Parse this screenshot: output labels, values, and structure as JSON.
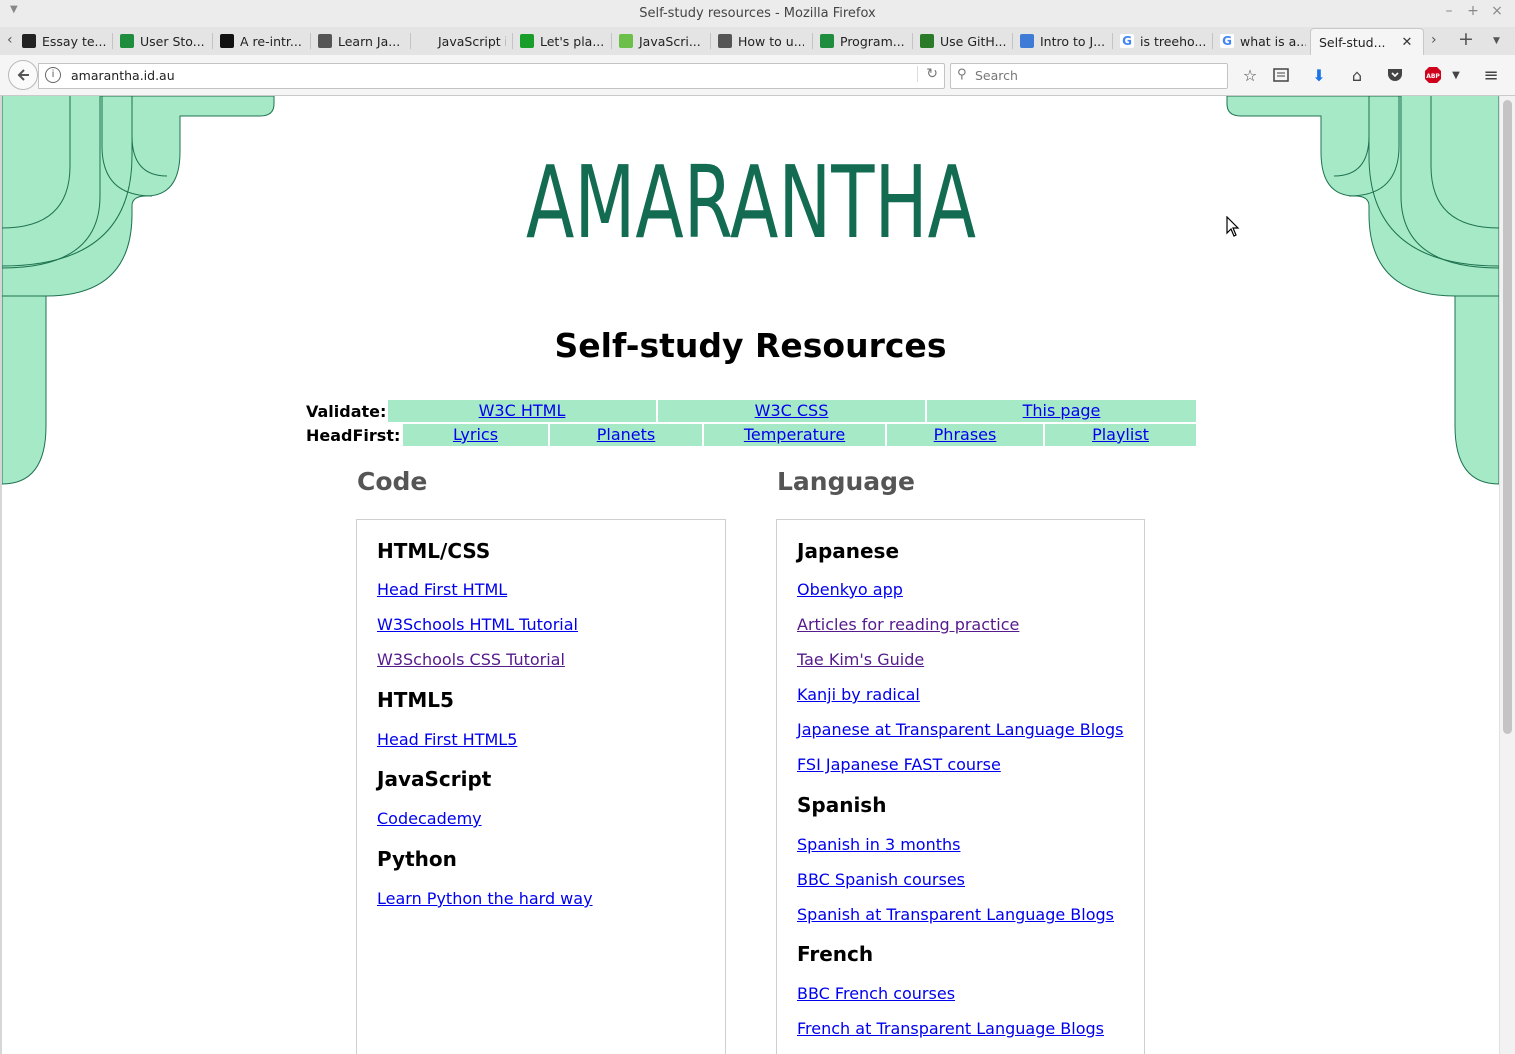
{
  "window": {
    "title": "Self-study resources - Mozilla Firefox"
  },
  "tabs": [
    {
      "label": "Essay te...",
      "icon": "text-icon",
      "color": "#222"
    },
    {
      "label": "User Sto...",
      "icon": "sheets-icon",
      "color": "#1e8e3e"
    },
    {
      "label": "A re-intr...",
      "icon": "mdn-icon",
      "color": "#111"
    },
    {
      "label": "Learn Ja...",
      "icon": "codecademy-icon",
      "color": "#555"
    },
    {
      "label": "JavaScript in ...",
      "icon": "blank-icon",
      "color": "#e4e4e4"
    },
    {
      "label": "Let's pla...",
      "icon": "eye-icon",
      "color": "#1a9e2a"
    },
    {
      "label": "JavaScri...",
      "icon": "w3-icon",
      "color": "#6cc04a"
    },
    {
      "label": "How to u...",
      "icon": "codecademy-icon",
      "color": "#555"
    },
    {
      "label": "Program...",
      "icon": "sheets-icon",
      "color": "#1e8e3e"
    },
    {
      "label": "Use GitH...",
      "icon": "terminal-icon",
      "color": "#2a7a2a"
    },
    {
      "label": "Intro to J...",
      "icon": "atom-icon",
      "color": "#3d7bd6"
    },
    {
      "label": "is treeho...",
      "icon": "google-icon",
      "color": "#fff"
    },
    {
      "label": "what is a...",
      "icon": "google-icon",
      "color": "#fff"
    }
  ],
  "active_tab": {
    "label": "Self-stud..."
  },
  "nav": {
    "url": "amarantha.id.au",
    "search_placeholder": "Search"
  },
  "page": {
    "logo": "AMARANTHA",
    "title": "Self-study Resources",
    "validate": {
      "label": "Validate:",
      "links": [
        "W3C HTML",
        "W3C CSS",
        "This page"
      ]
    },
    "headfirst": {
      "label": "HeadFirst:",
      "links": [
        "Lyrics",
        "Planets",
        "Temperature",
        "Phrases",
        "Playlist"
      ]
    },
    "code": {
      "heading": "Code",
      "sections": [
        {
          "title": "HTML/CSS",
          "links": [
            {
              "text": "Head First HTML",
              "visited": false
            },
            {
              "text": "W3Schools HTML Tutorial",
              "visited": false
            },
            {
              "text": "W3Schools CSS Tutorial",
              "visited": true
            }
          ]
        },
        {
          "title": "HTML5",
          "links": [
            {
              "text": "Head First HTML5",
              "visited": false
            }
          ]
        },
        {
          "title": "JavaScript",
          "links": [
            {
              "text": "Codecademy",
              "visited": false
            }
          ]
        },
        {
          "title": "Python",
          "links": [
            {
              "text": "Learn Python the hard way",
              "visited": false
            }
          ]
        }
      ]
    },
    "language": {
      "heading": "Language",
      "sections": [
        {
          "title": "Japanese",
          "links": [
            {
              "text": "Obenkyo app",
              "visited": false
            },
            {
              "text": "Articles for reading practice",
              "visited": true
            },
            {
              "text": "Tae Kim's Guide",
              "visited": true
            },
            {
              "text": "Kanji by radical",
              "visited": false
            },
            {
              "text": "Japanese at Transparent Language Blogs",
              "visited": false
            },
            {
              "text": "FSI Japanese FAST course",
              "visited": false
            }
          ]
        },
        {
          "title": "Spanish",
          "links": [
            {
              "text": "Spanish in 3 months",
              "visited": false
            },
            {
              "text": "BBC Spanish courses",
              "visited": false
            },
            {
              "text": "Spanish at Transparent Language Blogs",
              "visited": false
            }
          ]
        },
        {
          "title": "French",
          "links": [
            {
              "text": "BBC French courses",
              "visited": false
            },
            {
              "text": "French at Transparent Language Blogs",
              "visited": false
            }
          ]
        }
      ]
    }
  },
  "colors": {
    "mint": "#a6e9c7",
    "logo": "#136b52",
    "link": "#0000ee",
    "visited": "#551a8b"
  }
}
